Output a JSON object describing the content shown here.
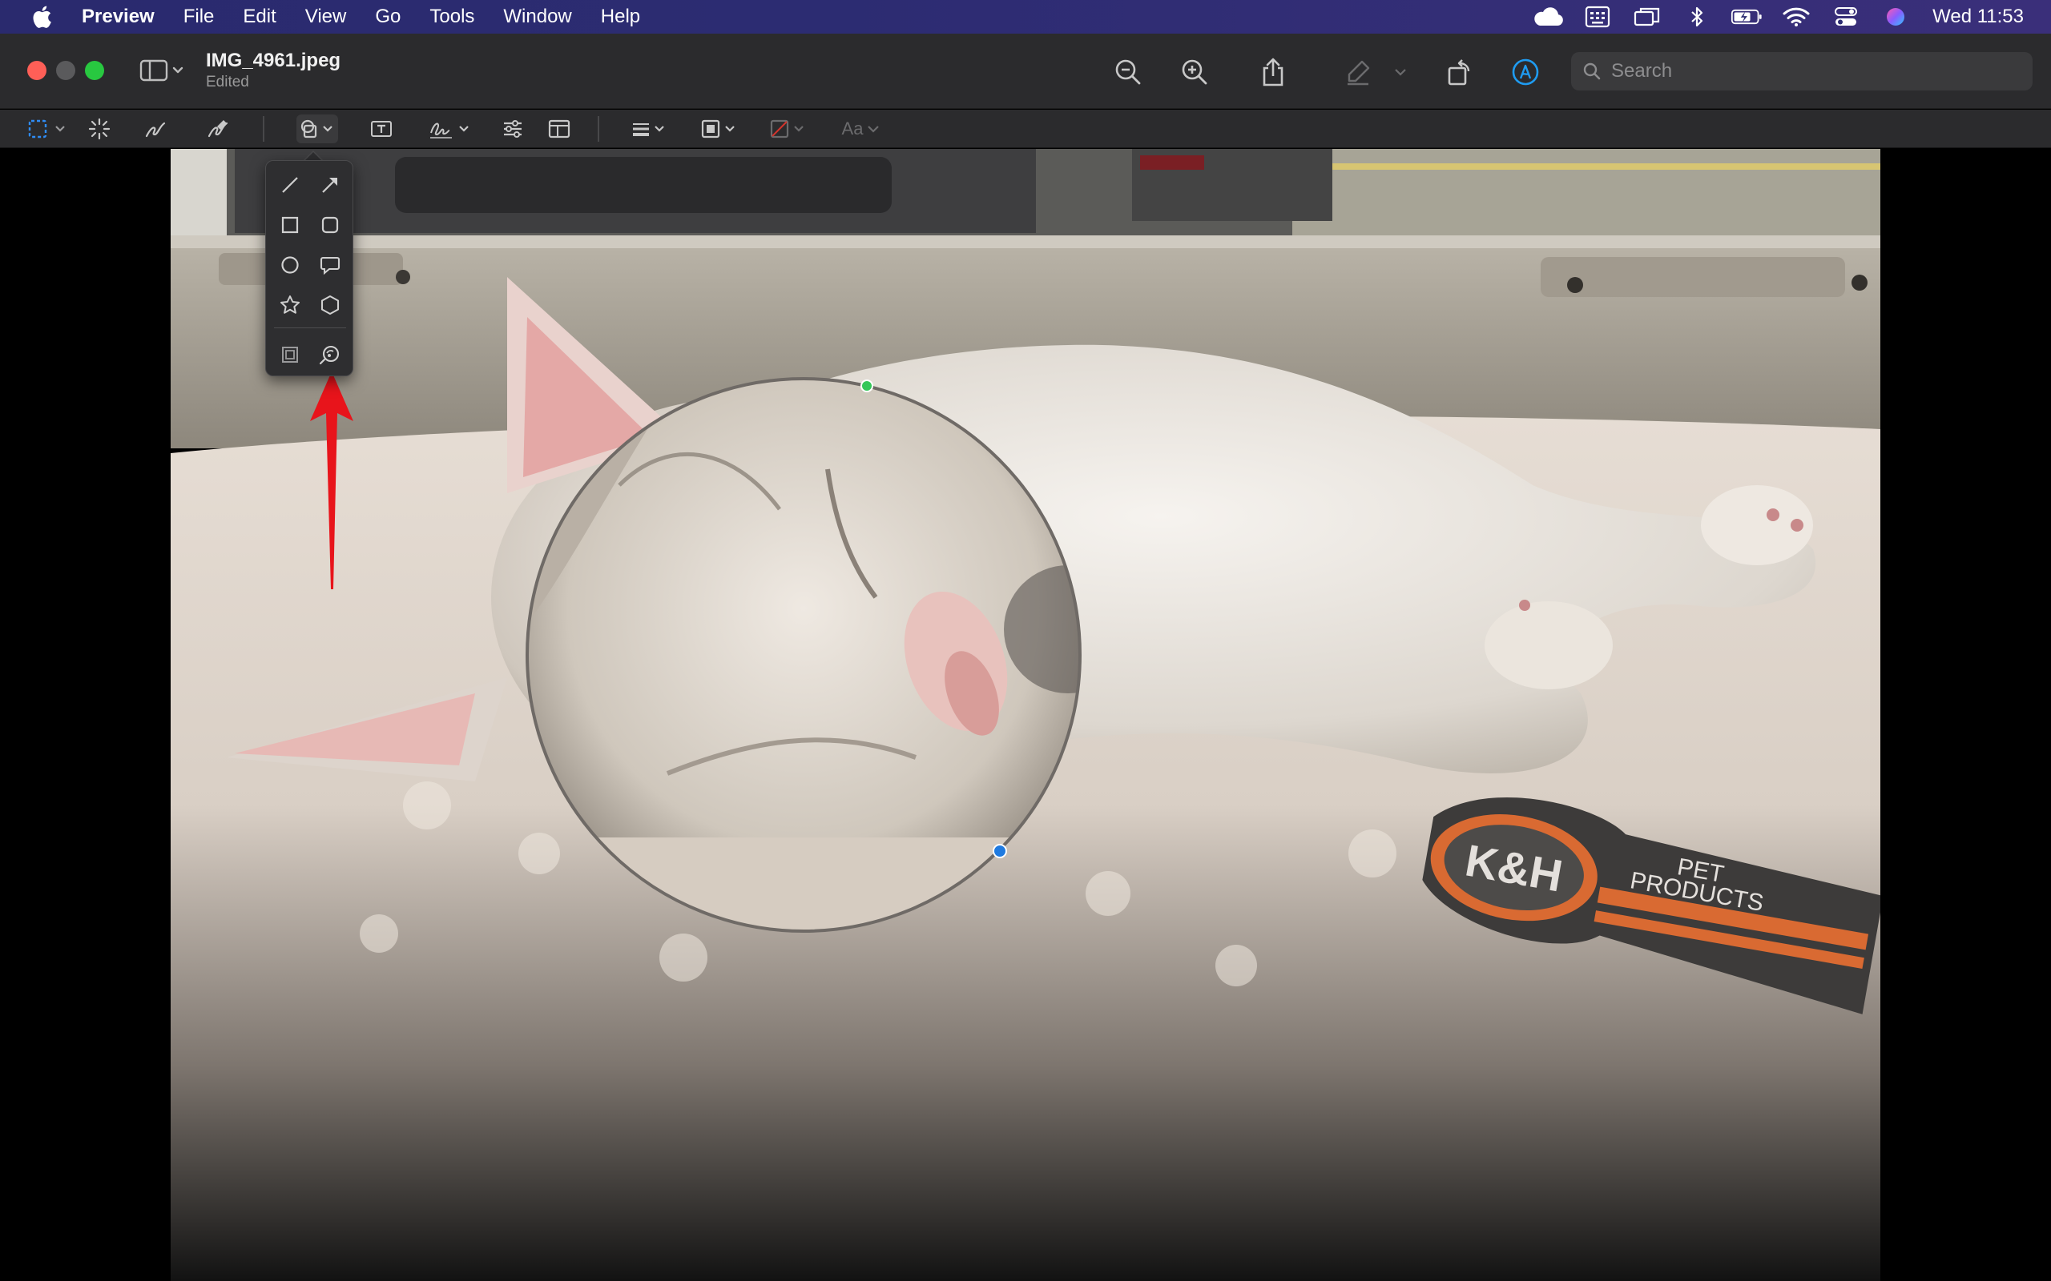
{
  "menubar": {
    "app_name": "Preview",
    "items": [
      "File",
      "Edit",
      "View",
      "Go",
      "Tools",
      "Window",
      "Help"
    ],
    "clock": "Wed 11:53",
    "status_icons": [
      "icloud-icon",
      "keyboard-viewer-icon",
      "screen-mirroring-icon",
      "bluetooth-icon",
      "battery-icon",
      "wifi-icon",
      "control-center-icon",
      "siri-icon"
    ]
  },
  "window": {
    "title": "IMG_4961.jpeg",
    "subtitle": "Edited"
  },
  "search": {
    "placeholder": "Search"
  },
  "toolbar": {
    "buttons": [
      "zoom-out-icon",
      "zoom-in-icon",
      "share-icon",
      "highlight-icon",
      "rotate-icon",
      "markup-icon"
    ]
  },
  "markup_toolbar": {
    "tools": [
      "rectangular-selection-icon",
      "instant-alpha-icon",
      "sketch-icon",
      "draw-icon",
      "shapes-icon",
      "text-icon",
      "sign-icon",
      "adjust-color-icon",
      "adjust-size-icon",
      "shape-style-icon",
      "border-color-icon",
      "fill-color-icon",
      "text-style-icon"
    ],
    "text_style_label": "Aa"
  },
  "shapes_popover": {
    "shapes": [
      "line-icon",
      "arrow-icon",
      "rectangle-icon",
      "rounded-rectangle-icon",
      "oval-icon",
      "speech-bubble-icon",
      "star-icon",
      "hexagon-icon",
      "mask-icon",
      "loupe-icon"
    ]
  },
  "image": {
    "badge_brand": "K&H",
    "badge_text_line1": "PET",
    "badge_text_line2": "PRODUCTS"
  },
  "colors": {
    "annotation_arrow": "#e8141b",
    "handle_start": "#34c759",
    "handle_end": "#1f7ae0"
  }
}
